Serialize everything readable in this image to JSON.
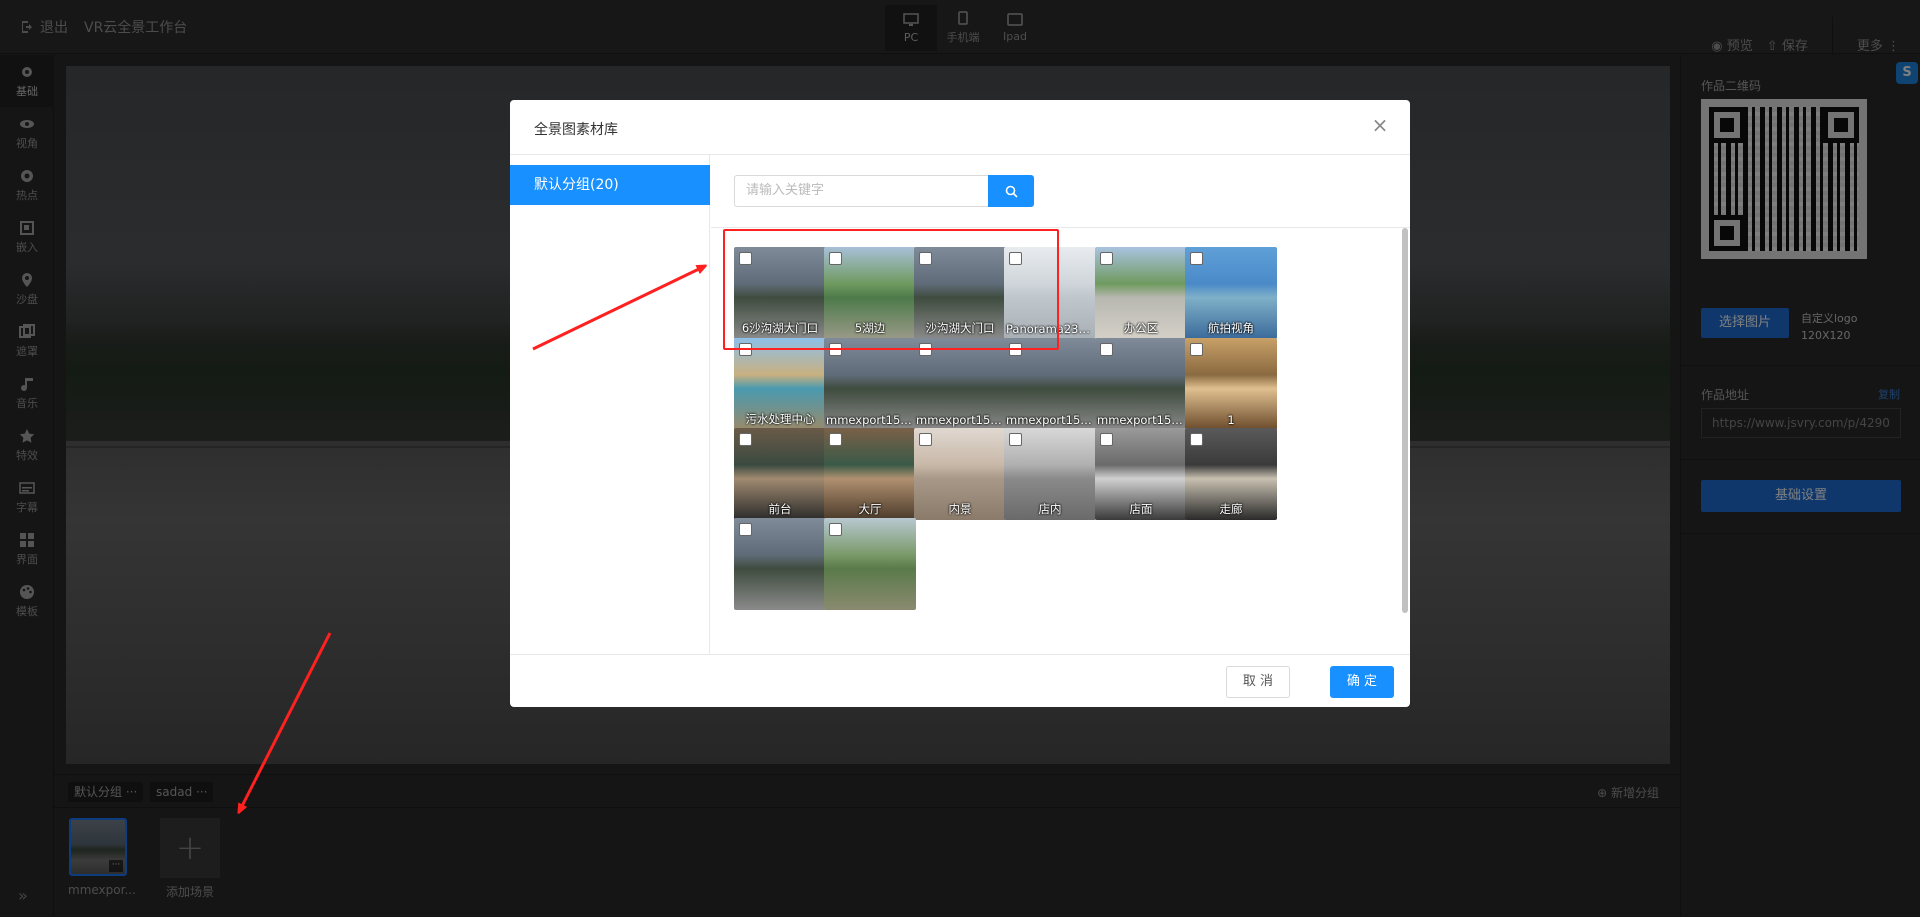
{
  "topbar": {
    "exit_label": "退出",
    "app_title": "VR云全景工作台",
    "devices": [
      {
        "label": "PC",
        "icon": "monitor-icon",
        "active": true
      },
      {
        "label": "手机端",
        "icon": "phone-icon",
        "active": false
      },
      {
        "label": "Ipad",
        "icon": "tablet-icon",
        "active": false
      }
    ],
    "preview_label": "预览",
    "save_label": "保存",
    "more_label": "更多"
  },
  "left_tools": [
    {
      "label": "基础",
      "icon": "gear-icon"
    },
    {
      "label": "视角",
      "icon": "eye-icon"
    },
    {
      "label": "热点",
      "icon": "target-icon"
    },
    {
      "label": "嵌入",
      "icon": "embed-icon"
    },
    {
      "label": "沙盘",
      "icon": "map-pin-icon"
    },
    {
      "label": "遮罩",
      "icon": "mask-icon"
    },
    {
      "label": "音乐",
      "icon": "music-icon"
    },
    {
      "label": "特效",
      "icon": "star-icon"
    },
    {
      "label": "字幕",
      "icon": "subtitle-icon"
    },
    {
      "label": "界面",
      "icon": "layout-icon"
    },
    {
      "label": "模板",
      "icon": "palette-icon"
    }
  ],
  "scene_bar": {
    "groups": [
      "默认分组 ···",
      "sadad ···"
    ],
    "new_group_label": "新增分组",
    "scenes": [
      {
        "label": "mmexpor..."
      }
    ],
    "add_scene_label": "添加场景"
  },
  "right_panel": {
    "qr_label": "作品二维码",
    "select_image_label": "选择图片",
    "logo_note_line1": "自定义logo",
    "logo_note_line2": "120X120",
    "url_label": "作品地址",
    "copy_label": "复制",
    "url_value": "https://www.jsvry.com/p/4290",
    "basic_settings_label": "基础设置"
  },
  "modal": {
    "title": "全景图素材库",
    "group_label": "默认分组(20)",
    "search_placeholder": "请输入关键字",
    "cancel_label": "取 消",
    "ok_label": "确 定",
    "items": [
      {
        "caption": "6沙沟湖大门口",
        "palette": [
          "#7f8b99",
          "#5f6b78",
          "#3f4c3f",
          "#8a8a8a"
        ]
      },
      {
        "caption": "5湖边",
        "palette": [
          "#a8c0d8",
          "#6f9a5f",
          "#4d7a4a",
          "#9a9a88"
        ]
      },
      {
        "caption": "沙沟湖大门口",
        "palette": [
          "#7f8b99",
          "#5f6b78",
          "#3f4c3f",
          "#8a8a8a"
        ]
      },
      {
        "caption": "Panorama23_1...",
        "palette": [
          "#e8ecef",
          "#cfd5da",
          "#bfc6cc",
          "#a9b0b5"
        ]
      },
      {
        "caption": "办公区",
        "palette": [
          "#a9c3e0",
          "#6f9a5f",
          "#b8b8b0",
          "#d4d0c8"
        ]
      },
      {
        "caption": "航拍视角",
        "palette": [
          "#5fa0d8",
          "#4a8ac8",
          "#7fb0c8",
          "#3a6a9a"
        ]
      },
      {
        "caption": "污水处理中心",
        "palette": [
          "#8ec0e8",
          "#c8b080",
          "#4a9ab0",
          "#9a8a6a"
        ]
      },
      {
        "caption": "mmexport1597...",
        "palette": [
          "#7f8b99",
          "#5f6b78",
          "#3f4c3f",
          "#8a8a8a"
        ]
      },
      {
        "caption": "mmexport1597...",
        "palette": [
          "#7f8b99",
          "#5f6b78",
          "#3f4c3f",
          "#8a8a8a"
        ]
      },
      {
        "caption": "mmexport1597...",
        "palette": [
          "#7f8b99",
          "#5f6b78",
          "#3f4c3f",
          "#8a8a8a"
        ]
      },
      {
        "caption": "mmexport1597...",
        "palette": [
          "#7f8b99",
          "#5f6b78",
          "#3f4c3f",
          "#8a8a8a"
        ]
      },
      {
        "caption": "1",
        "palette": [
          "#c8a068",
          "#8a6a40",
          "#e0c090",
          "#6a4a2a"
        ]
      },
      {
        "caption": "前台",
        "palette": [
          "#6a5a48",
          "#3a4a40",
          "#a08a70",
          "#2a2a2a"
        ]
      },
      {
        "caption": "大厅",
        "palette": [
          "#7a6048",
          "#3a5a48",
          "#b09070",
          "#4a3a2a"
        ]
      },
      {
        "caption": "内景",
        "palette": [
          "#e0d8d0",
          "#c8b8a8",
          "#a89888",
          "#8a7a6a"
        ]
      },
      {
        "caption": "店内",
        "palette": [
          "#d8d8d8",
          "#b0b0b0",
          "#8a8a8a",
          "#6a6a6a"
        ]
      },
      {
        "caption": "店面",
        "palette": [
          "#9a9a9a",
          "#6a6a6a",
          "#d0d0d0",
          "#3a3a3a"
        ]
      },
      {
        "caption": "走廊",
        "palette": [
          "#5a5a5a",
          "#3a3a3a",
          "#c8c0b0",
          "#2a2a2a"
        ]
      },
      {
        "caption": "",
        "palette": [
          "#7f8b99",
          "#5f6b78",
          "#3f4c3f",
          "#8a8a8a"
        ]
      },
      {
        "caption": "",
        "palette": [
          "#b8c8d0",
          "#7a9a6a",
          "#5a7a4a",
          "#8a8a70"
        ]
      }
    ]
  },
  "colors": {
    "accent": "#1890ff",
    "highlight": "#ff2020"
  }
}
